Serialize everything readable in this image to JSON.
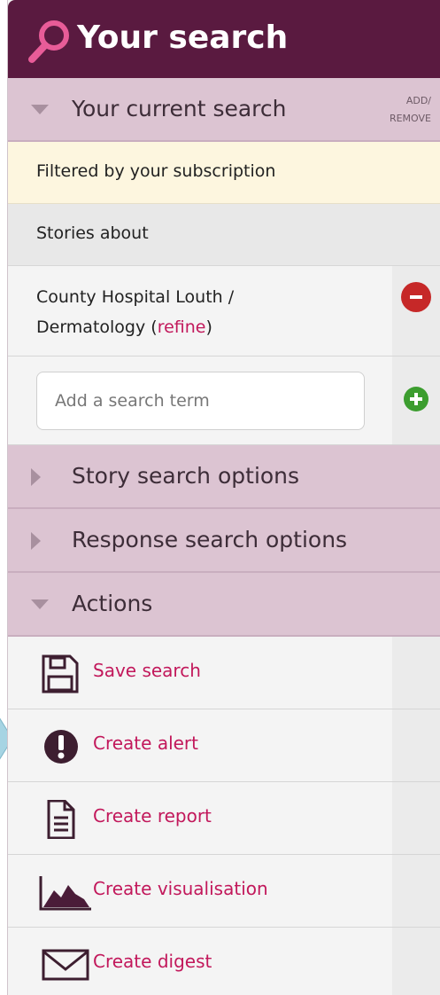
{
  "header": {
    "title": "Your search",
    "icon": "magnifier-icon"
  },
  "current_search": {
    "label": "Your current search",
    "add_remove_line1": "ADD/",
    "add_remove_line2": "REMOVE",
    "filter_text": "Filtered by your subscription",
    "stories_about": "Stories about",
    "term_line1": "County Hospital Louth /",
    "term_line2": "Dermatology (",
    "refine_label": "refine",
    "term_suffix": ")",
    "input_placeholder": "Add a search term"
  },
  "sections": {
    "story_options": "Story search options",
    "response_options": "Response search options",
    "actions": "Actions"
  },
  "actions": [
    {
      "label": "Save search",
      "icon": "floppy-disk-icon"
    },
    {
      "label": "Create alert",
      "icon": "alert-exclamation-icon"
    },
    {
      "label": "Create report",
      "icon": "document-icon"
    },
    {
      "label": "Create visualisation",
      "icon": "area-chart-icon"
    },
    {
      "label": "Create digest",
      "icon": "envelope-icon"
    }
  ],
  "colors": {
    "header_bg": "#5a1a40",
    "section_bg": "#dcc4d2",
    "filter_bg": "#fdf6df",
    "link": "#c2185b",
    "remove": "#c62828",
    "add": "#3c9d2f",
    "arrow_tab": "#a6d4e3"
  }
}
